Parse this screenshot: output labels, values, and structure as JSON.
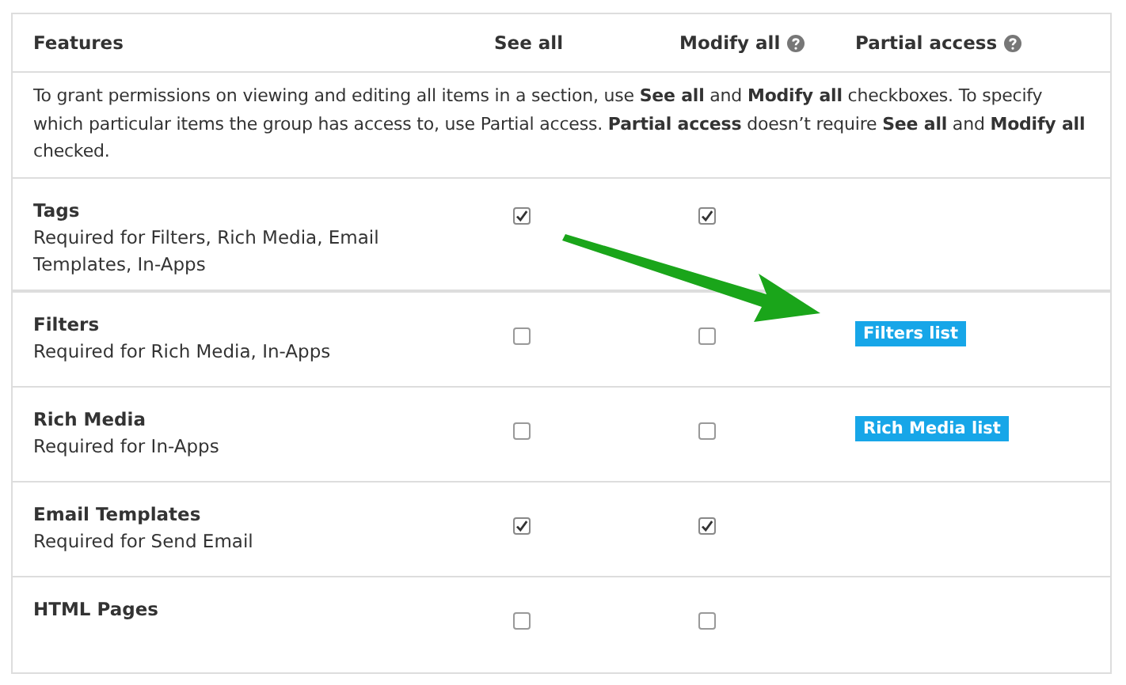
{
  "table": {
    "columns": [
      {
        "label": "Features",
        "help": false
      },
      {
        "label": "See all",
        "help": false
      },
      {
        "label": "Modify all",
        "help": true
      },
      {
        "label": "Partial access",
        "help": true
      }
    ],
    "intro": "To grant permissions on viewing and editing all items in a section, use **See all** and **Modify all** checkboxes. To specify which particular items the group has access to, use Partial access. **Partial access** doesn’t require **See all** and **Modify all** checked.",
    "rows": [
      {
        "name": "Tags",
        "note": "Required for Filters, Rich Media, Email Templates, In-Apps",
        "see_all": true,
        "modify_all": true
      },
      {
        "name": "Filters",
        "note": "Required for Rich Media, In-Apps",
        "see_all": false,
        "modify_all": false,
        "partial": "Filters list"
      },
      {
        "name": "Rich Media",
        "note": "Required for In-Apps",
        "see_all": false,
        "modify_all": false,
        "partial": "Rich Media list"
      },
      {
        "name": "Email Templates",
        "note": "Required for Send Email",
        "see_all": true,
        "modify_all": true
      },
      {
        "name": "HTML Pages",
        "see_all": false,
        "modify_all": false
      }
    ]
  }
}
